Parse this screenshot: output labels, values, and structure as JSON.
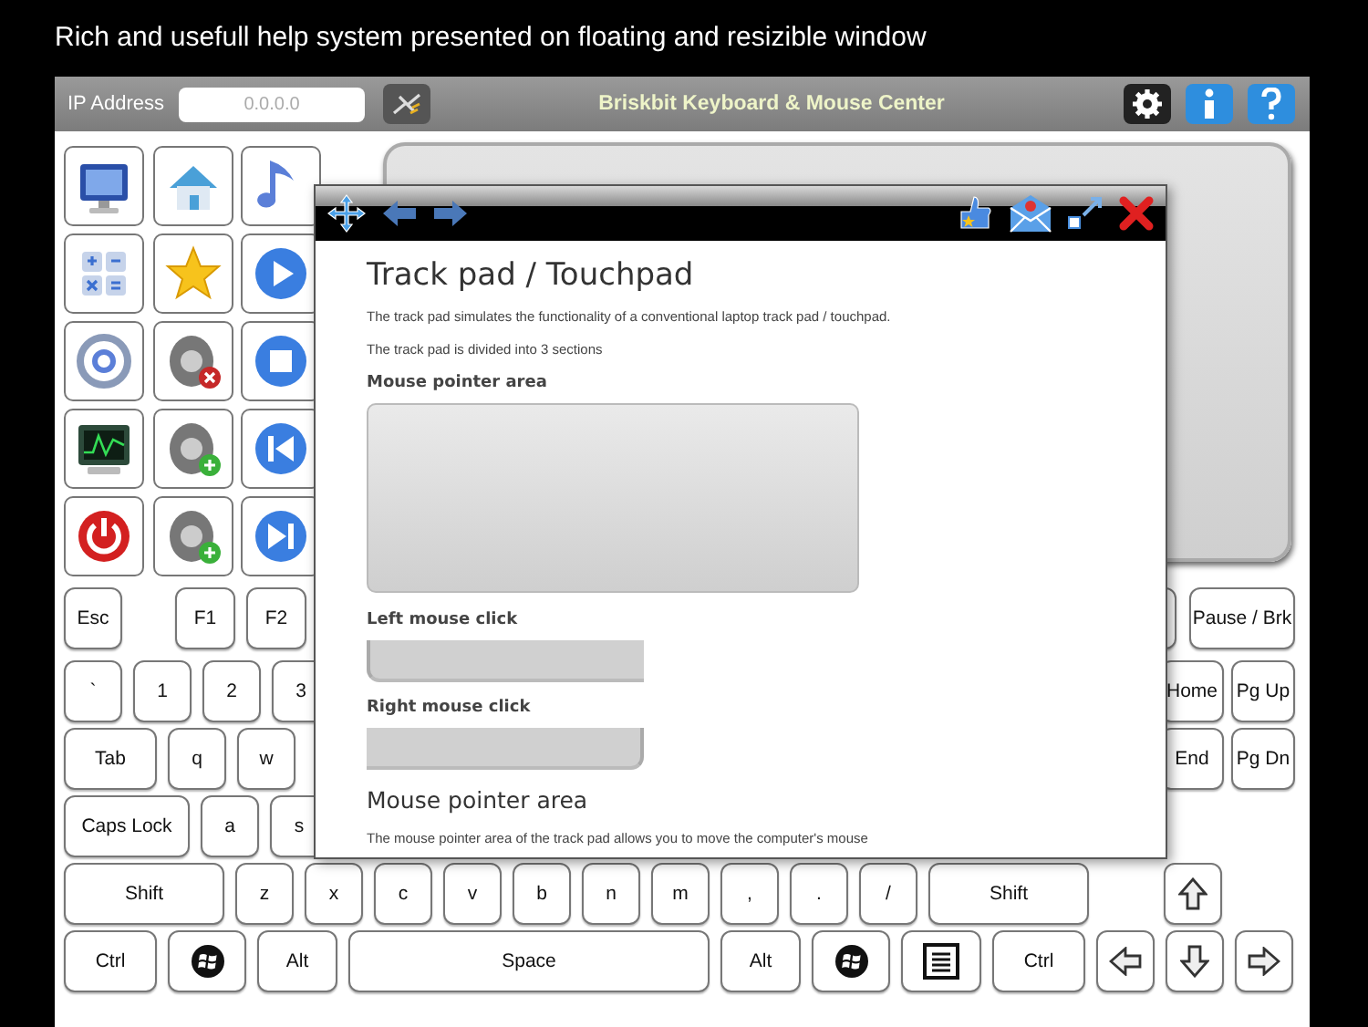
{
  "caption": "Rich and usefull help system presented on floating and resizible window",
  "toolbar": {
    "ip_label": "IP Address",
    "ip_field": {
      "placeholder": "0.0.0.0"
    },
    "title": "Briskbit Keyboard & Mouse Center"
  },
  "help_window": {
    "title": "Track pad / Touchpad",
    "intro": [
      "The track pad simulates the functionality of a conventional laptop track pad / touchpad.",
      "The track pad is divided into 3 sections"
    ],
    "sections": [
      {
        "kind": "area",
        "heading": "Mouse pointer area"
      },
      {
        "kind": "left-click",
        "heading": "Left mouse click"
      },
      {
        "kind": "right-click",
        "heading": "Right mouse click"
      }
    ],
    "next_heading": "Mouse pointer area",
    "next_text": "The mouse pointer area of the track pad allows you to move the computer's mouse"
  },
  "keyboard": {
    "rows": [
      {
        "left": [
          {
            "label": "Esc",
            "kind": "esc"
          },
          {
            "label": "F1",
            "kind": "fn"
          },
          {
            "label": "F2",
            "kind": "fn"
          }
        ],
        "right": [
          {
            "kind": "partial"
          },
          {
            "label": "Pause / Brk",
            "kind": "pause"
          }
        ]
      },
      {
        "left": [
          {
            "label": "`",
            "kind": "key"
          },
          {
            "label": "1",
            "kind": "key"
          },
          {
            "label": "2",
            "kind": "key"
          },
          {
            "label": "3",
            "kind": "key"
          }
        ],
        "right": [
          {
            "label": "Home",
            "kind": "nav"
          },
          {
            "label": "Pg Up",
            "kind": "nav"
          }
        ]
      },
      {
        "left": [
          {
            "label": "Tab",
            "kind": "wide"
          },
          {
            "label": "q",
            "kind": "key"
          },
          {
            "label": "w",
            "kind": "key"
          }
        ],
        "right": [
          {
            "label": "End",
            "kind": "nav"
          },
          {
            "label": "Pg Dn",
            "kind": "nav"
          }
        ]
      },
      {
        "left": [
          {
            "label": "Caps Lock",
            "kind": "caps"
          },
          {
            "label": "a",
            "kind": "key"
          },
          {
            "label": "s",
            "kind": "key"
          }
        ],
        "right": []
      },
      {
        "left": [
          {
            "label": "Shift",
            "kind": "shift"
          },
          {
            "label": "z",
            "kind": "key"
          },
          {
            "label": "x",
            "kind": "key"
          },
          {
            "label": "c",
            "kind": "key"
          },
          {
            "label": "v",
            "kind": "key"
          },
          {
            "label": "b",
            "kind": "key"
          },
          {
            "label": "n",
            "kind": "key"
          },
          {
            "label": "m",
            "kind": "key"
          },
          {
            "label": ",",
            "kind": "key"
          },
          {
            "label": ".",
            "kind": "key"
          },
          {
            "label": "/",
            "kind": "key"
          },
          {
            "label": "Shift",
            "kind": "shift"
          }
        ],
        "right": [
          {
            "kind": "arrow-up"
          }
        ]
      },
      {
        "left": [
          {
            "label": "Ctrl",
            "kind": "wide"
          },
          {
            "kind": "win"
          },
          {
            "label": "Alt",
            "kind": "alt"
          },
          {
            "label": "Space",
            "kind": "space"
          },
          {
            "label": "Alt",
            "kind": "alt"
          },
          {
            "kind": "win"
          },
          {
            "kind": "menu"
          },
          {
            "label": "Ctrl",
            "kind": "wide"
          },
          {
            "kind": "arrow-left"
          },
          {
            "kind": "arrow-down"
          },
          {
            "kind": "arrow-right"
          }
        ],
        "right": []
      }
    ]
  }
}
